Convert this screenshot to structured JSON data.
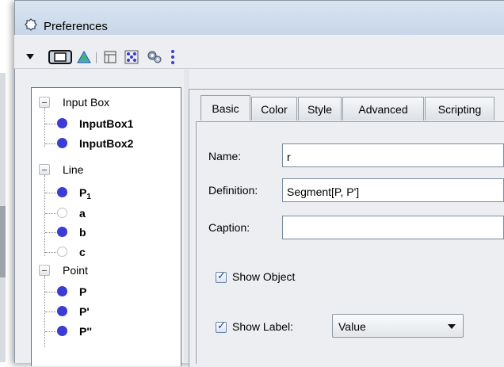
{
  "window": {
    "title": "Preferences"
  },
  "toolbar": {
    "icons": [
      "menu-arrow-icon",
      "graphics-view-icon",
      "algebra-view-icon",
      "layout-icon",
      "objects-grid-icon",
      "settings-gears-icon",
      "more-options-icon"
    ]
  },
  "tree": {
    "groups": [
      {
        "label": "Input Box",
        "items": [
          {
            "label": "InputBox1",
            "sub": "",
            "filled": true
          },
          {
            "label": "InputBox2",
            "sub": "",
            "filled": true
          }
        ]
      },
      {
        "label": "Line",
        "items": [
          {
            "label": "P",
            "sub": "1",
            "filled": true
          },
          {
            "label": "a",
            "sub": "",
            "filled": false
          },
          {
            "label": "b",
            "sub": "",
            "filled": true
          },
          {
            "label": "c",
            "sub": "",
            "filled": false
          }
        ]
      },
      {
        "label": "Point",
        "items": [
          {
            "label": "P",
            "sub": "",
            "filled": true
          },
          {
            "label": "P'",
            "sub": "",
            "filled": true
          },
          {
            "label": "P''",
            "sub": "",
            "filled": true
          }
        ]
      }
    ]
  },
  "tabs": [
    "Basic",
    "Color",
    "Style",
    "Advanced",
    "Scripting"
  ],
  "basic": {
    "name_label": "Name:",
    "name_value": "r",
    "definition_label": "Definition:",
    "definition_value": "Segment[P, P']",
    "caption_label": "Caption:",
    "caption_value": "",
    "show_object_label": "Show Object",
    "show_object_checked": true,
    "show_label_label": "Show Label:",
    "show_label_checked": true,
    "show_label_value": "Value"
  },
  "colors": {
    "accent_point": "#3b3bd6",
    "title_bar": "#c7d6e8"
  }
}
